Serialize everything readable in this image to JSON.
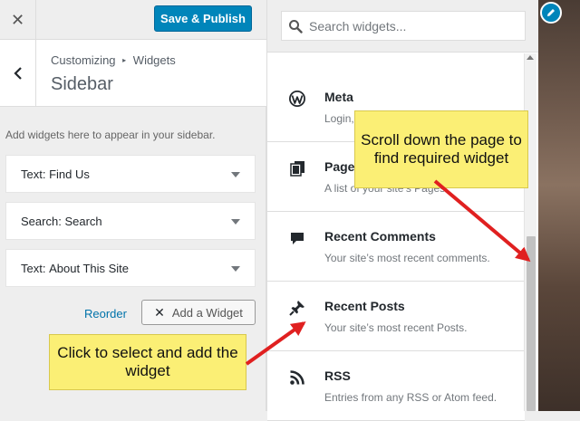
{
  "topbar": {
    "close_label": "✕",
    "publish_label": "Save & Publish"
  },
  "section": {
    "breadcrumb_parent": "Customizing",
    "breadcrumb_separator": "▸",
    "breadcrumb_current": "Widgets",
    "title": "Sidebar",
    "description": "Add widgets here to appear in your sidebar."
  },
  "widgets": [
    {
      "type": "Text:",
      "title": "Find Us"
    },
    {
      "type": "Search:",
      "title": "Search"
    },
    {
      "type": "Text:",
      "title": "About This Site"
    }
  ],
  "actions": {
    "reorder_label": "Reorder",
    "add_widget_icon": "✕",
    "add_widget_label": "Add a Widget"
  },
  "search": {
    "placeholder": "Search widgets..."
  },
  "available_widgets": [
    {
      "name": "Meta",
      "description": "Login, RSS, & WordPress.org links.",
      "icon": "wordpress-icon"
    },
    {
      "name": "Pages",
      "description": "A list of your site’s Pages.",
      "icon": "pages-icon"
    },
    {
      "name": "Recent Comments",
      "description": "Your site’s most recent comments.",
      "icon": "comment-icon"
    },
    {
      "name": "Recent Posts",
      "description": "Your site’s most recent Posts.",
      "icon": "pushpin-icon"
    },
    {
      "name": "RSS",
      "description": "Entries from any RSS or Atom feed.",
      "icon": "rss-icon"
    }
  ],
  "annotations": {
    "scroll_callout": "Scroll down the page to find required widget",
    "click_callout": "Click to select and add the widget"
  },
  "colors": {
    "publish_blue": "#0085ba",
    "link_blue": "#0073aa",
    "callout_yellow": "#fbef75",
    "arrow_red": "#e02020"
  }
}
